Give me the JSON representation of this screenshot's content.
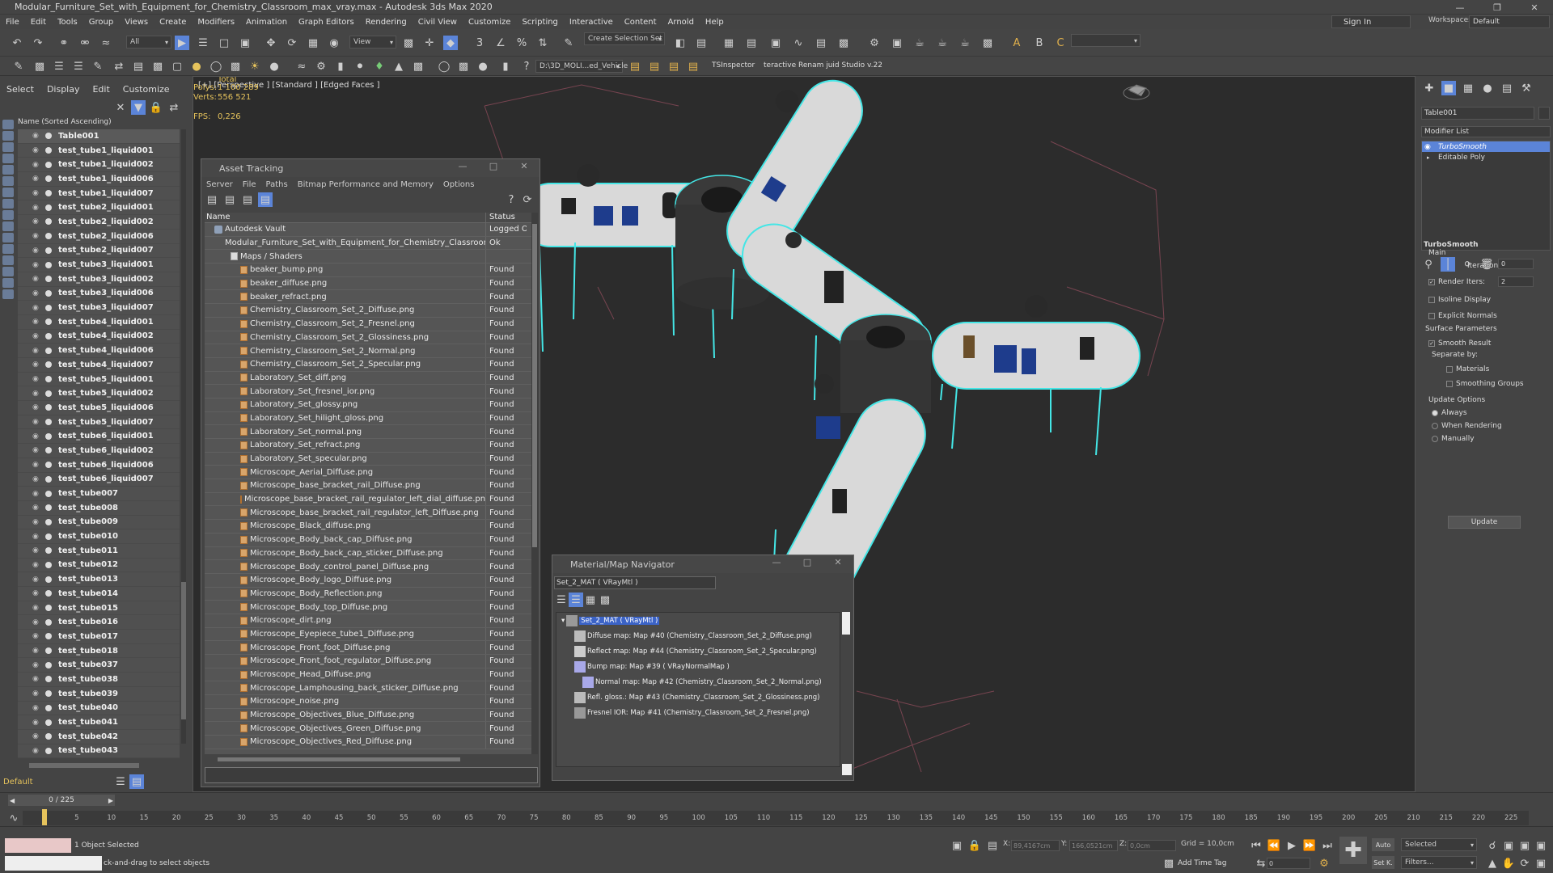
{
  "app": {
    "title": "Modular_Furniture_Set_with_Equipment_for_Chemistry_Classroom_max_vray.max - Autodesk 3ds Max 2020"
  },
  "menu": [
    "File",
    "Edit",
    "Tools",
    "Group",
    "Views",
    "Create",
    "Modifiers",
    "Animation",
    "Graph Editors",
    "Rendering",
    "Civil View",
    "Customize",
    "Scripting",
    "Interactive",
    "Content",
    "Arnold",
    "Help"
  ],
  "signin": "Sign In",
  "workspaces_label": "Workspaces:",
  "workspace_value": "Default",
  "toolbar": {
    "filter": "All",
    "view": "View",
    "selection_set": "Create Selection Set",
    "path": "D:\\3D_MOLI...ed_Vehicle",
    "ts_inspector": "TSInspector",
    "renamer": "teractive Renam juid Studio v.22"
  },
  "scene_explorer": {
    "tabs": [
      "Select",
      "Display",
      "Edit",
      "Customize"
    ],
    "header": "Name (Sorted Ascending)",
    "items": [
      "Table001",
      "test_tube1_liquid001",
      "test_tube1_liquid002",
      "test_tube1_liquid006",
      "test_tube1_liquid007",
      "test_tube2_liquid001",
      "test_tube2_liquid002",
      "test_tube2_liquid006",
      "test_tube2_liquid007",
      "test_tube3_liquid001",
      "test_tube3_liquid002",
      "test_tube3_liquid006",
      "test_tube3_liquid007",
      "test_tube4_liquid001",
      "test_tube4_liquid002",
      "test_tube4_liquid006",
      "test_tube4_liquid007",
      "test_tube5_liquid001",
      "test_tube5_liquid002",
      "test_tube5_liquid006",
      "test_tube5_liquid007",
      "test_tube6_liquid001",
      "test_tube6_liquid002",
      "test_tube6_liquid006",
      "test_tube6_liquid007",
      "test_tube007",
      "test_tube008",
      "test_tube009",
      "test_tube010",
      "test_tube011",
      "test_tube012",
      "test_tube013",
      "test_tube014",
      "test_tube015",
      "test_tube016",
      "test_tube017",
      "test_tube018",
      "test_tube037",
      "test_tube038",
      "test_tube039",
      "test_tube040",
      "test_tube041",
      "test_tube042",
      "test_tube043"
    ],
    "layer": "Default"
  },
  "viewport": {
    "label": "[+] [Perspective ] [Standard ] [Edged Faces ]",
    "total": "Total",
    "polys_label": "Polys:",
    "polys": "1 100 289",
    "verts_label": "Verts:",
    "verts": "556 521",
    "fps_label": "FPS:",
    "fps": "0,226"
  },
  "asset_tracking": {
    "title": "Asset Tracking",
    "menu": [
      "Server",
      "File",
      "Paths",
      "Bitmap Performance and Memory",
      "Options"
    ],
    "col_name": "Name",
    "col_status": "Status",
    "rows": [
      {
        "name": "Autodesk Vault",
        "status": "Logged O",
        "level": 0,
        "kind": "vault"
      },
      {
        "name": "Modular_Furniture_Set_with_Equipment_for_Chemistry_Classroom_ma...",
        "status": "Ok",
        "level": 1,
        "kind": "max"
      },
      {
        "name": "Maps / Shaders",
        "status": "",
        "level": 2,
        "kind": "folder"
      },
      {
        "name": "beaker_bump.png",
        "status": "Found",
        "level": 3,
        "kind": "file"
      },
      {
        "name": "beaker_diffuse.png",
        "status": "Found",
        "level": 3,
        "kind": "file"
      },
      {
        "name": "beaker_refract.png",
        "status": "Found",
        "level": 3,
        "kind": "file"
      },
      {
        "name": "Chemistry_Classroom_Set_2_Diffuse.png",
        "status": "Found",
        "level": 3,
        "kind": "file"
      },
      {
        "name": "Chemistry_Classroom_Set_2_Fresnel.png",
        "status": "Found",
        "level": 3,
        "kind": "file"
      },
      {
        "name": "Chemistry_Classroom_Set_2_Glossiness.png",
        "status": "Found",
        "level": 3,
        "kind": "file"
      },
      {
        "name": "Chemistry_Classroom_Set_2_Normal.png",
        "status": "Found",
        "level": 3,
        "kind": "file"
      },
      {
        "name": "Chemistry_Classroom_Set_2_Specular.png",
        "status": "Found",
        "level": 3,
        "kind": "file"
      },
      {
        "name": "Laboratory_Set_diff.png",
        "status": "Found",
        "level": 3,
        "kind": "file"
      },
      {
        "name": "Laboratory_Set_fresnel_ior.png",
        "status": "Found",
        "level": 3,
        "kind": "file"
      },
      {
        "name": "Laboratory_Set_glossy.png",
        "status": "Found",
        "level": 3,
        "kind": "file"
      },
      {
        "name": "Laboratory_Set_hilight_gloss.png",
        "status": "Found",
        "level": 3,
        "kind": "file"
      },
      {
        "name": "Laboratory_Set_normal.png",
        "status": "Found",
        "level": 3,
        "kind": "file"
      },
      {
        "name": "Laboratory_Set_refract.png",
        "status": "Found",
        "level": 3,
        "kind": "file"
      },
      {
        "name": "Laboratory_Set_specular.png",
        "status": "Found",
        "level": 3,
        "kind": "file"
      },
      {
        "name": "Microscope_Aerial_Diffuse.png",
        "status": "Found",
        "level": 3,
        "kind": "file"
      },
      {
        "name": "Microscope_base_bracket_rail_Diffuse.png",
        "status": "Found",
        "level": 3,
        "kind": "file"
      },
      {
        "name": "Microscope_base_bracket_rail_regulator_left_dial_diffuse.png",
        "status": "Found",
        "level": 3,
        "kind": "file"
      },
      {
        "name": "Microscope_base_bracket_rail_regulator_left_Diffuse.png",
        "status": "Found",
        "level": 3,
        "kind": "file"
      },
      {
        "name": "Microscope_Black_diffuse.png",
        "status": "Found",
        "level": 3,
        "kind": "file"
      },
      {
        "name": "Microscope_Body_back_cap_Diffuse.png",
        "status": "Found",
        "level": 3,
        "kind": "file"
      },
      {
        "name": "Microscope_Body_back_cap_sticker_Diffuse.png",
        "status": "Found",
        "level": 3,
        "kind": "file"
      },
      {
        "name": "Microscope_Body_control_panel_Diffuse.png",
        "status": "Found",
        "level": 3,
        "kind": "file"
      },
      {
        "name": "Microscope_Body_logo_Diffuse.png",
        "status": "Found",
        "level": 3,
        "kind": "file"
      },
      {
        "name": "Microscope_Body_Reflection.png",
        "status": "Found",
        "level": 3,
        "kind": "file"
      },
      {
        "name": "Microscope_Body_top_Diffuse.png",
        "status": "Found",
        "level": 3,
        "kind": "file"
      },
      {
        "name": "Microscope_dirt.png",
        "status": "Found",
        "level": 3,
        "kind": "file"
      },
      {
        "name": "Microscope_Eyepiece_tube1_Diffuse.png",
        "status": "Found",
        "level": 3,
        "kind": "file"
      },
      {
        "name": "Microscope_Front_foot_Diffuse.png",
        "status": "Found",
        "level": 3,
        "kind": "file"
      },
      {
        "name": "Microscope_Front_foot_regulator_Diffuse.png",
        "status": "Found",
        "level": 3,
        "kind": "file"
      },
      {
        "name": "Microscope_Head_Diffuse.png",
        "status": "Found",
        "level": 3,
        "kind": "file"
      },
      {
        "name": "Microscope_Lamphousing_back_sticker_Diffuse.png",
        "status": "Found",
        "level": 3,
        "kind": "file"
      },
      {
        "name": "Microscope_noise.png",
        "status": "Found",
        "level": 3,
        "kind": "file"
      },
      {
        "name": "Microscope_Objectives_Blue_Diffuse.png",
        "status": "Found",
        "level": 3,
        "kind": "file"
      },
      {
        "name": "Microscope_Objectives_Green_Diffuse.png",
        "status": "Found",
        "level": 3,
        "kind": "file"
      },
      {
        "name": "Microscope_Objectives_Red_Diffuse.png",
        "status": "Found",
        "level": 3,
        "kind": "file"
      }
    ]
  },
  "material_navigator": {
    "title": "Material/Map Navigator",
    "selector": "Set_2_MAT  ( VRayMtl )",
    "root": "Set_2_MAT  ( VRayMtl )",
    "items": [
      "Diffuse map: Map #40 (Chemistry_Classroom_Set_2_Diffuse.png)",
      "Reflect map: Map #44 (Chemistry_Classroom_Set_2_Specular.png)",
      "Bump map: Map #39  ( VRayNormalMap )",
      "Normal map: Map #42 (Chemistry_Classroom_Set_2_Normal.png)",
      "Refl. gloss.: Map #43 (Chemistry_Classroom_Set_2_Glossiness.png)",
      "Fresnel IOR: Map #41 (Chemistry_Classroom_Set_2_Fresnel.png)"
    ]
  },
  "command_panel": {
    "object_name": "Table001",
    "modifier_list": "Modifier List",
    "stack": [
      "TurboSmooth",
      "Editable Poly"
    ],
    "turbosmooth": {
      "title": "TurboSmooth",
      "main": "Main",
      "iterations_label": "Iterations:",
      "iterations": "0",
      "render_iters_label": "Render Iters:",
      "render_iters": "2",
      "isoline": "Isoline Display",
      "explicit": "Explicit Normals",
      "surface": "Surface Parameters",
      "smooth_result": "Smooth Result",
      "separate": "Separate by:",
      "materials": "Materials",
      "smoothing": "Smoothing Groups",
      "update_options": "Update Options",
      "always": "Always",
      "when_rendering": "When Rendering",
      "manually": "Manually",
      "update": "Update"
    }
  },
  "timeline": {
    "frame": "0 / 225",
    "ticks": [
      "0",
      "5",
      "10",
      "15",
      "20",
      "25",
      "30",
      "35",
      "40",
      "45",
      "50",
      "55",
      "60",
      "65",
      "70",
      "75",
      "80",
      "85",
      "90",
      "95",
      "100",
      "105",
      "110",
      "115",
      "120",
      "125",
      "130",
      "135",
      "140",
      "145",
      "150",
      "155",
      "160",
      "165",
      "170",
      "175",
      "180",
      "185",
      "190",
      "195",
      "200",
      "205",
      "210",
      "215",
      "220",
      "225"
    ]
  },
  "status": {
    "selected": "1 Object Selected",
    "prompt": "ck-and-drag to select objects",
    "x_label": "X:",
    "x": "89,4167cm",
    "y_label": "Y:",
    "y": "166,0521cm",
    "z_label": "Z:",
    "z": "0,0cm",
    "grid": "Grid = 10,0cm",
    "add_time_tag": "Add Time Tag",
    "auto": "Auto",
    "set_k": "Set K.",
    "selected_dd": "Selected",
    "filters": "Filters...",
    "frame_value": "0"
  },
  "colors": {
    "wire": "#44e6e6",
    "accent": "#5b84d8",
    "highlight": "#3b63c7",
    "stat": "#e6c35c"
  }
}
